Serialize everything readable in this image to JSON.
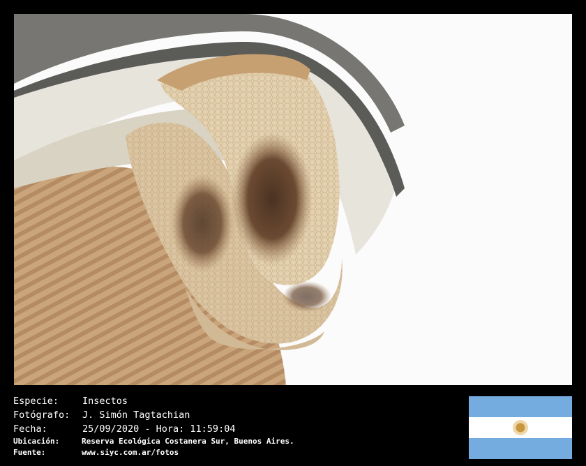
{
  "photo": {
    "subject_icon": "honeycomb-photo",
    "colors": {
      "background": "#fbfbfb",
      "comb": "#d9c3a0",
      "brood": "#6b4a32",
      "metal": "#5b5b58"
    }
  },
  "caption": {
    "species_label": "Especie:",
    "species_value": "Insectos",
    "photographer_label": "Fotógrafo:",
    "photographer_value": "J. Simón Tagtachian",
    "date_label": "Fecha:",
    "date_value": "25/09/2020 - Hora: 11:59:04",
    "location_label": "Ubicación:",
    "location_value": "Reserva Ecológica Costanera Sur, Buenos Aires.",
    "source_label": "Fuente:",
    "source_value": "www.siyc.com.ar/fotos"
  },
  "flag": {
    "icon": "argentina-flag-icon",
    "colors": {
      "celeste": "#74acdf",
      "white": "#ffffff",
      "sun": "#c8963e"
    }
  }
}
